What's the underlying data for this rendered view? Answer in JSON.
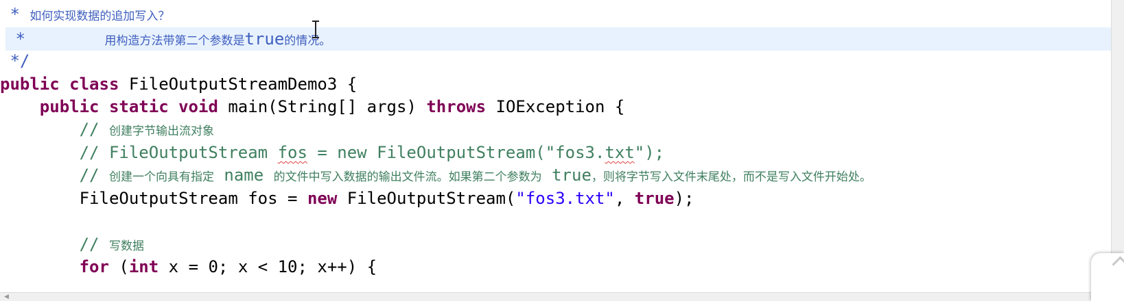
{
  "editor": {
    "lines": {
      "jd1_star": " * ",
      "jd1_text": "如何实现数据的追加写入？",
      "jd2_star": " *",
      "jd2_pad": "        ",
      "jd2_text_a": "用构造方法带第二个参数是",
      "jd2_code": "true",
      "jd2_text_b": "的情况。",
      "jd3": " */",
      "l4_kw1": "public",
      "l4_kw2": "class",
      "l4_rest": " FileOutputStreamDemo3 {",
      "l5_indent": "    ",
      "l5_kw1": "public",
      "l5_kw2": "static",
      "l5_kw3": "void",
      "l5_mid": " main(String[] args) ",
      "l5_kw4": "throws",
      "l5_rest": " IOException {",
      "c1_indent": "        ",
      "c1_slash": "// ",
      "c1_text": "创建字节输出流对象",
      "c2_indent": "        ",
      "c2_a": "// FileOutputStream ",
      "c2_fos": "fos",
      "c2_b": " = new FileOutputStream(\"fos3.",
      "c2_txt": "txt",
      "c2_c": "\");",
      "c3_indent": "        ",
      "c3_slash": "// ",
      "c3_t1": "创建一个向具有指定",
      "c3_name": " name ",
      "c3_t2": "的文件中写入数据的输出文件流。如果第二个参数为",
      "c3_true": " true",
      "c3_t3": "，则将字节写入文件末尾处，而不是写入文件开始处。",
      "l9_indent": "        ",
      "l9_a": "FileOutputStream fos = ",
      "l9_new": "new",
      "l9_b": " FileOutputStream(",
      "l9_str": "\"fos3.txt\"",
      "l9_c": ", ",
      "l9_true": "true",
      "l9_d": ");",
      "c4_indent": "        ",
      "c4_slash": "// ",
      "c4_text": "写数据",
      "l12_indent": "        ",
      "l12_for": "for",
      "l12_a": " (",
      "l12_int": "int",
      "l12_b": " x = 0; x < 10; x++) {"
    }
  },
  "colors": {
    "keyword": "#7f0055",
    "comment": "#3f7f5f",
    "javadoc": "#3f5fbf",
    "string": "#2a00ff",
    "current_line": "#e8f2fe"
  },
  "icons": {
    "caret": "text-cursor-ibeam-icon",
    "scroll_left": "scroll-left-arrow-icon",
    "corner": "chevron-up-icon"
  }
}
